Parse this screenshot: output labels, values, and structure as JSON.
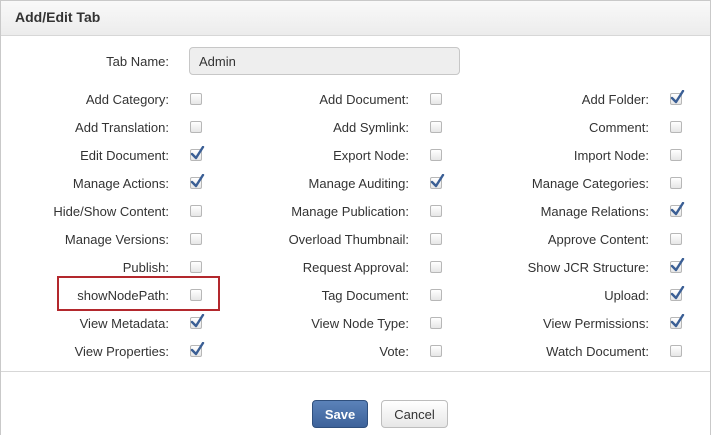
{
  "dialog": {
    "title": "Add/Edit Tab",
    "tab_name_label": "Tab Name:",
    "tab_name_value": "Admin"
  },
  "permissions": [
    [
      {
        "label": "Add Category:",
        "checked": false
      },
      {
        "label": "Add Translation:",
        "checked": false
      },
      {
        "label": "Edit Document:",
        "checked": true
      },
      {
        "label": "Manage Actions:",
        "checked": true
      },
      {
        "label": "Hide/Show Content:",
        "checked": false
      },
      {
        "label": "Manage Versions:",
        "checked": false
      },
      {
        "label": "Publish:",
        "checked": false
      },
      {
        "label": "showNodePath:",
        "checked": false
      },
      {
        "label": "View Metadata:",
        "checked": true
      },
      {
        "label": "View Properties:",
        "checked": true
      }
    ],
    [
      {
        "label": "Add Document:",
        "checked": false
      },
      {
        "label": "Add Symlink:",
        "checked": false
      },
      {
        "label": "Export Node:",
        "checked": false
      },
      {
        "label": "Manage Auditing:",
        "checked": true
      },
      {
        "label": "Manage Publication:",
        "checked": false
      },
      {
        "label": "Overload Thumbnail:",
        "checked": false
      },
      {
        "label": "Request Approval:",
        "checked": false
      },
      {
        "label": "Tag Document:",
        "checked": false
      },
      {
        "label": "View Node Type:",
        "checked": false
      },
      {
        "label": "Vote:",
        "checked": false
      }
    ],
    [
      {
        "label": "Add Folder:",
        "checked": true
      },
      {
        "label": "Comment:",
        "checked": false
      },
      {
        "label": "Import Node:",
        "checked": false
      },
      {
        "label": "Manage Categories:",
        "checked": false
      },
      {
        "label": "Manage Relations:",
        "checked": true
      },
      {
        "label": "Approve Content:",
        "checked": false
      },
      {
        "label": "Show JCR Structure:",
        "checked": true
      },
      {
        "label": "Upload:",
        "checked": true
      },
      {
        "label": "View Permissions:",
        "checked": true
      },
      {
        "label": "Watch Document:",
        "checked": false
      }
    ]
  ],
  "buttons": {
    "save": "Save",
    "cancel": "Cancel"
  },
  "colors": {
    "check": "#3b5f95",
    "highlight": "#b3282d",
    "primary_button": "#4a6fa5"
  }
}
